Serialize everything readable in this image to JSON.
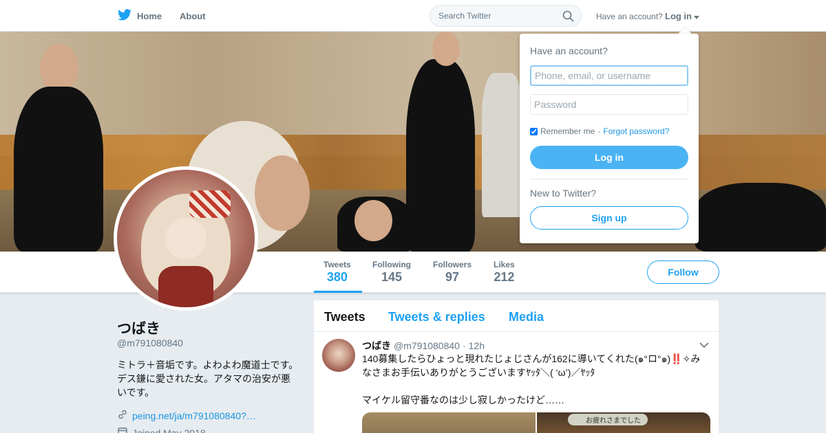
{
  "colors": {
    "accent": "#1da1f2",
    "link": "#1b95e0",
    "muted": "#657786",
    "background": "#e6ecf0"
  },
  "topnav": {
    "logo_icon": "twitter-bird-icon",
    "home_label": "Home",
    "about_label": "About",
    "search_placeholder": "Search Twitter",
    "have_account": "Have an account?",
    "login_label": "Log in"
  },
  "stats": [
    {
      "label": "Tweets",
      "value": "380"
    },
    {
      "label": "Following",
      "value": "145"
    },
    {
      "label": "Followers",
      "value": "97"
    },
    {
      "label": "Likes",
      "value": "212"
    }
  ],
  "follow_label": "Follow",
  "profile": {
    "name": "つばき",
    "handle": "@m791080840",
    "bio": "ミトラ＋音垢です。よわよわ魔道士です。デス鎌に愛された女。アタマの治安が悪いです。",
    "link": "peing.net/ja/m791080840?…",
    "joined": "Joined May 2018"
  },
  "timeline": {
    "tabs": [
      "Tweets",
      "Tweets & replies",
      "Media"
    ]
  },
  "tweet": {
    "name": "つばき",
    "handle": "@m791080840",
    "dot": "·",
    "time": "12h",
    "text": "140募集したらひょっと現れたじょじさんが162に導いてくれた(๑°ロ°๑)‼️✧みなさまお手伝いありがとうございますﾔｯﾀ＼( ‘ω’)／ﾔｯﾀ\n\nマイケル留守番なのは少し寂しかったけど……",
    "media_caption": "お疲れさまでした"
  },
  "login_dropdown": {
    "title": "Have an account?",
    "username_placeholder": "Phone, email, or username",
    "password_placeholder": "Password",
    "remember_label": "Remember me",
    "separator": "·",
    "forgot_label": "Forgot password?",
    "login_button": "Log in",
    "new_label": "New to Twitter?",
    "signup_button": "Sign up"
  }
}
